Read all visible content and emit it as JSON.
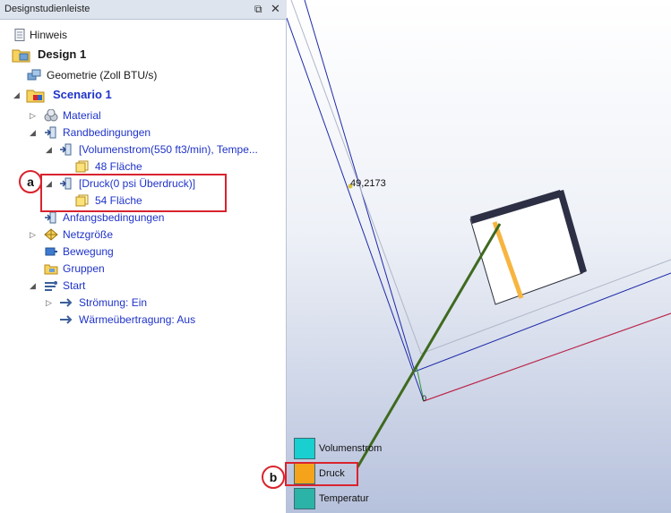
{
  "panel": {
    "title": "Designstudienleiste",
    "tree": [
      {
        "label": "Hinweis"
      },
      {
        "label": "Design 1"
      },
      {
        "label": "Geometrie (Zoll BTU/s)"
      },
      {
        "label": "Scenario 1"
      },
      {
        "label": "Material"
      },
      {
        "label": "Randbedingungen"
      },
      {
        "label": "[Volumenstrom(550 ft3/min), Tempe..."
      },
      {
        "label": "48 Fläche"
      },
      {
        "label": "[Druck(0 psi Überdruck)]"
      },
      {
        "label": "54 Fläche"
      },
      {
        "label": "Anfangsbedingungen"
      },
      {
        "label": "Netzgröße"
      },
      {
        "label": "Bewegung"
      },
      {
        "label": "Gruppen"
      },
      {
        "label": "Start"
      },
      {
        "label": "Strömung: Ein"
      },
      {
        "label": "Wärmeübertragung: Aus"
      }
    ]
  },
  "viewport": {
    "point_label": "49,2173",
    "origin_label": "0",
    "legend": [
      {
        "label": "Volumenstrom",
        "color": "#19cfcf"
      },
      {
        "label": "Druck",
        "color": "#f5a31a"
      },
      {
        "label": "Temperatur",
        "color": "#2bb3a7"
      }
    ]
  },
  "callouts": {
    "a": "a",
    "b": "b"
  },
  "colors": {
    "link_blue": "#1f33c9",
    "callout_red": "#d9232e",
    "highlight_orange": "#f5a31a"
  }
}
